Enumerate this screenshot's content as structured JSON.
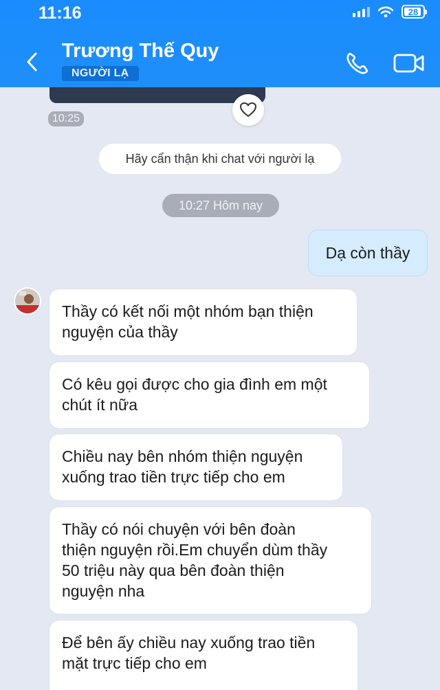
{
  "status_bar": {
    "time": "11:16",
    "battery": "28"
  },
  "header": {
    "contact_name": "Trương Thế Quy",
    "badge": "NGƯỜI LẠ",
    "accent_color": "#1a8cff"
  },
  "chat": {
    "prev_message_time": "10:25",
    "stranger_notice": "Hãy cẩn thận khi chat với người lạ",
    "date_separator": "10:27 Hôm nay",
    "sent_message": "Dạ còn thầy",
    "received_messages": [
      {
        "lines": [
          "Thầy có kết nối một nhóm bạn thiện",
          "nguyện của thầy"
        ]
      },
      {
        "lines": [
          "Có kêu gọi được cho gia đình em một",
          "chút ít nữa"
        ]
      },
      {
        "lines": [
          "Chiều nay bên nhóm thiện nguyện",
          "xuống trao tiền trực tiếp cho em"
        ]
      },
      {
        "lines": [
          "Thầy có nói chuyện với bên đoàn",
          "thiện nguyện rồi.Em chuyển dùm thầy",
          "50 triệu này qua bên đoàn thiện",
          "nguyện nha"
        ]
      },
      {
        "lines": [
          "Để bên ấy chiều nay xuống trao tiền",
          "mặt trực tiếp cho em"
        ]
      }
    ]
  },
  "icons": [
    "back-icon",
    "phone-icon",
    "video-call-icon",
    "heart-icon",
    "signal-icon",
    "wifi-icon",
    "battery-icon"
  ]
}
